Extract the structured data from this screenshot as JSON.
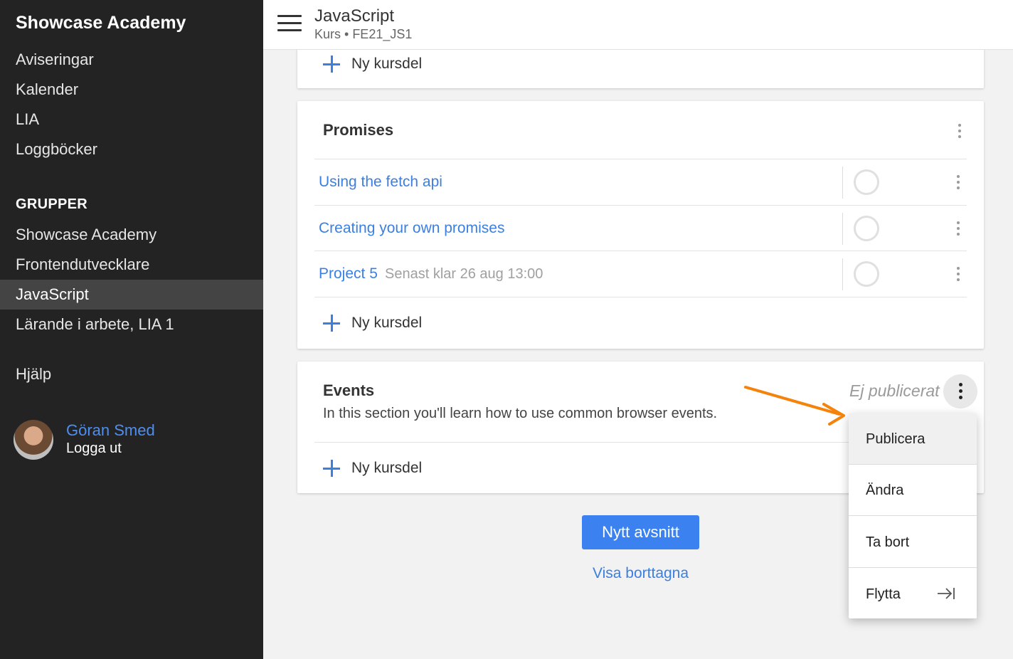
{
  "sidebar": {
    "brand": "Showcase Academy",
    "nav": [
      "Aviseringar",
      "Kalender",
      "LIA",
      "Loggböcker"
    ],
    "groups_heading": "GRUPPER",
    "groups": [
      "Showcase Academy",
      "Frontendutvecklare",
      "JavaScript",
      "Lärande i arbete, LIA 1"
    ],
    "active_group": "JavaScript",
    "help": "Hjälp",
    "user": {
      "name": "Göran Smed",
      "logout": "Logga ut"
    }
  },
  "header": {
    "title": "JavaScript",
    "subtitle": "Kurs • FE21_JS1"
  },
  "main": {
    "add_part_label": "Ny kursdel",
    "promises": {
      "title": "Promises",
      "items": [
        {
          "label": "Using the fetch api",
          "meta": ""
        },
        {
          "label": "Creating your own promises",
          "meta": ""
        },
        {
          "label": "Project 5",
          "meta": "Senast klar 26 aug 13:00"
        }
      ]
    },
    "events": {
      "title": "Events",
      "description": "In this section you'll learn how to use common browser events.",
      "status": "Ej publicerat"
    },
    "new_section_button": "Nytt avsnitt",
    "show_deleted_link": "Visa borttagna"
  },
  "menu": {
    "items": [
      "Publicera",
      "Ändra",
      "Ta bort",
      "Flytta"
    ]
  },
  "colors": {
    "accent": "#3b82f0",
    "link": "#3b7fe0",
    "sidebar_bg": "#232323",
    "annotation_arrow": "#f5820a"
  }
}
